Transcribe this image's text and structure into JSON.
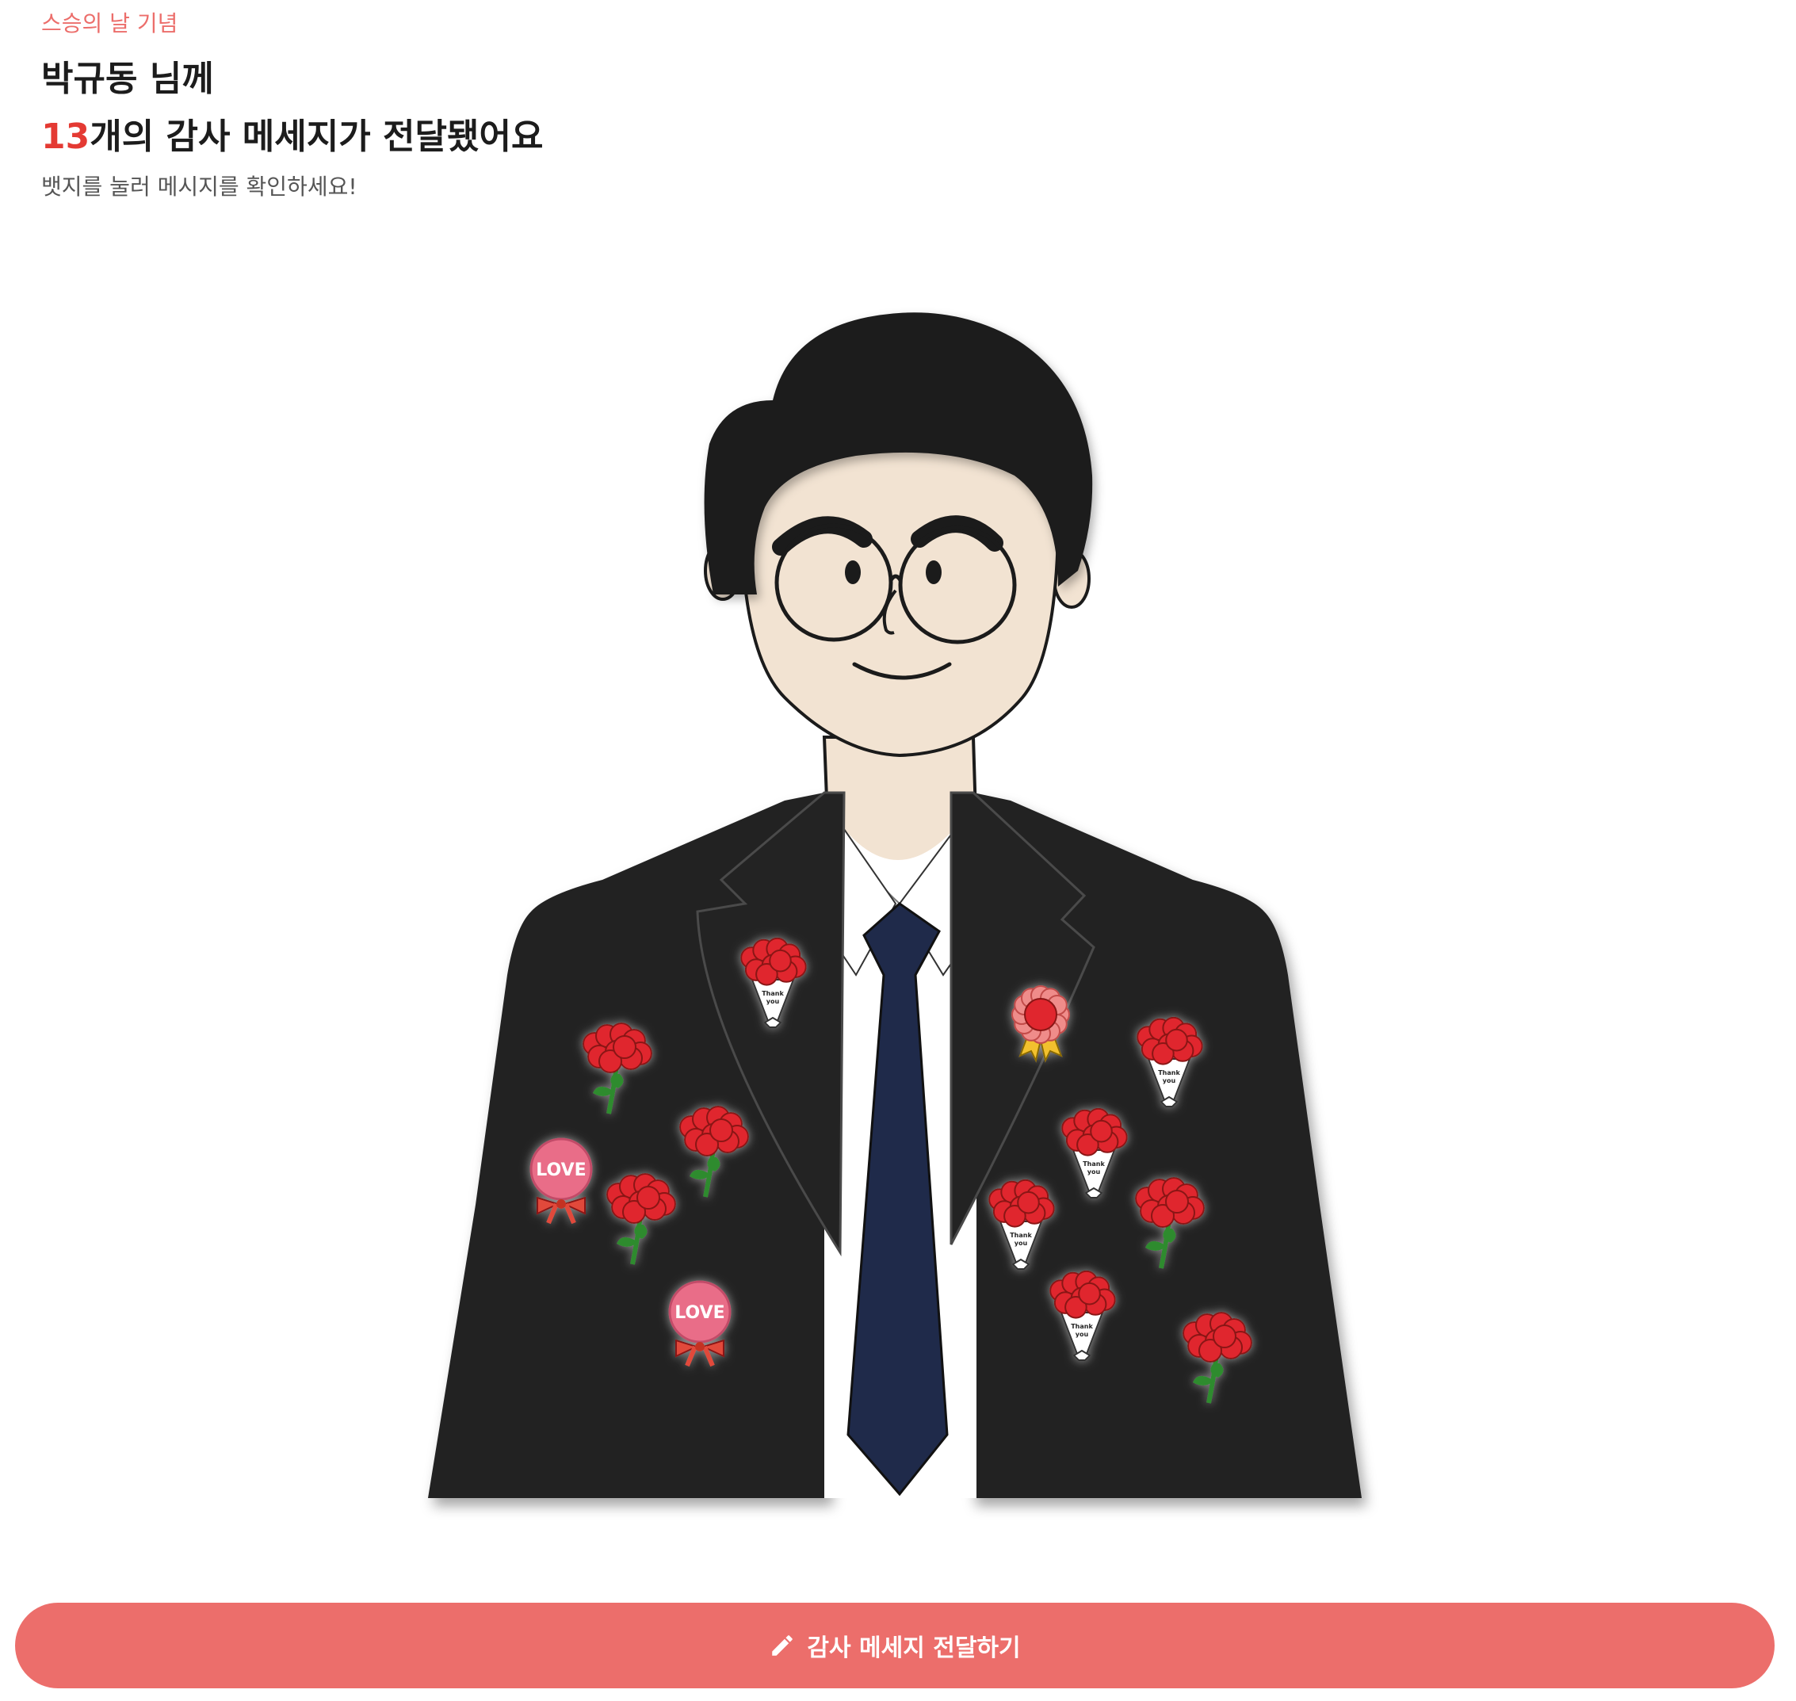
{
  "header": {
    "eyebrow": "스승의 날 기념",
    "recipient_line": "박규동 님께",
    "message_count": "13",
    "message_count_suffix": "개의 감사 메세지가 전달됐어요",
    "hint": "뱃지를 눌러 메시지를 확인하세요!"
  },
  "badges": [
    {
      "type": "bouquet",
      "text": "Thank you"
    },
    {
      "type": "carnation"
    },
    {
      "type": "carnation"
    },
    {
      "type": "love",
      "text": "LOVE"
    },
    {
      "type": "carnation"
    },
    {
      "type": "love",
      "text": "LOVE"
    },
    {
      "type": "rosette"
    },
    {
      "type": "bouquet",
      "text": "Thank you"
    },
    {
      "type": "bouquet",
      "text": "Thank you"
    },
    {
      "type": "bouquet",
      "text": "Thank you"
    },
    {
      "type": "carnation"
    },
    {
      "type": "bouquet",
      "text": "Thank you"
    },
    {
      "type": "carnation"
    }
  ],
  "cta": {
    "label": "감사 메세지 전달하기",
    "icon": "pencil-icon"
  },
  "colors": {
    "accent": "#ec6e6b",
    "count": "#e43a33",
    "suit": "#222222",
    "tie": "#1f2a4a",
    "skin": "#f2e3d2",
    "hair": "#1b1b1b",
    "carnation": "#e0282e"
  }
}
